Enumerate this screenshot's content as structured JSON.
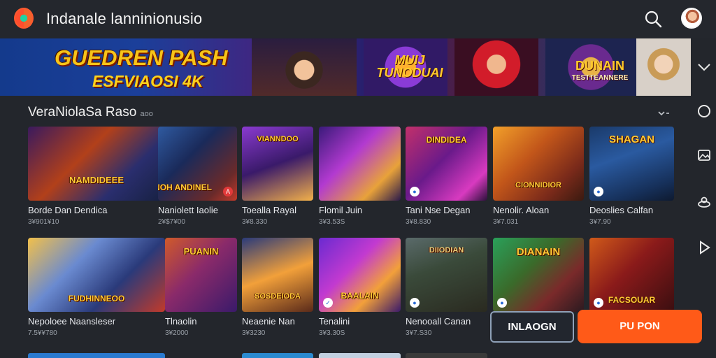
{
  "header": {
    "title": "Indanale lanninionusio"
  },
  "banner": {
    "title": "GUEDREN PASH",
    "subtitle": "ESFVIAOSI 4K",
    "game1": "MUIJ TUNODUAI",
    "game2": "DUNAIN",
    "game2_sub": "TESTTEANNERE"
  },
  "section": {
    "title": "VeraNiolaSa Raso",
    "title_suffix": "aoo"
  },
  "row1": [
    {
      "title": "Borde Dan Dendica",
      "meta": "3¥901¥10",
      "thumb_label": "NAMDIDEEE",
      "thumb_label2": "BONOH ANDINEL"
    },
    {
      "title": "Naniolett Iaolie",
      "meta": "2¥$7¥00",
      "thumb_label": ""
    },
    {
      "title": "Toealla Rayal",
      "meta": "3¥8.330",
      "thumb_label": "VIANNDOO"
    },
    {
      "title": "Flomil Juin",
      "meta": "3¥3.53S",
      "thumb_label": ""
    },
    {
      "title": "Tani Nse Degan",
      "meta": "3¥8.830",
      "thumb_label": "DINDIDEA"
    },
    {
      "title": "Nenolir. Aloan",
      "meta": "3¥7.031",
      "thumb_label": "CIONNIDIOR"
    },
    {
      "title": "Deoslies Calfan",
      "meta": "3¥7.90",
      "thumb_label": "SHAGAN"
    }
  ],
  "row2": [
    {
      "title": "Nepoloee Naansleser",
      "meta": "7.5¥¥780",
      "thumb_label": "FUDHINNEOO"
    },
    {
      "title": "Tlnaolin",
      "meta": "3¥2000",
      "thumb_label": "PUANIN"
    },
    {
      "title": "Neaenie Nan",
      "meta": "3¥3230",
      "thumb_label": "SOSDEIODA"
    },
    {
      "title": "Tenalini",
      "meta": "3¥3.30S",
      "thumb_label": "BAALAIN"
    },
    {
      "title": "Nenooall Canan",
      "meta": "3¥7.S30",
      "thumb_label": "DIIODIAN"
    },
    {
      "title": "",
      "meta": "",
      "thumb_label": "DIANAIN"
    },
    {
      "title": "",
      "meta": "",
      "thumb_label": "FACSOUAR"
    }
  ],
  "buttons": {
    "login": "INLAOGN",
    "join": "PU PON"
  },
  "icons": {
    "search": "search-icon",
    "rail": [
      "chevron-down-icon",
      "circle-icon",
      "image-icon",
      "cloud-icon",
      "play-icon"
    ]
  },
  "colors": {
    "background": "#23262c",
    "accent": "#ff5a18"
  }
}
